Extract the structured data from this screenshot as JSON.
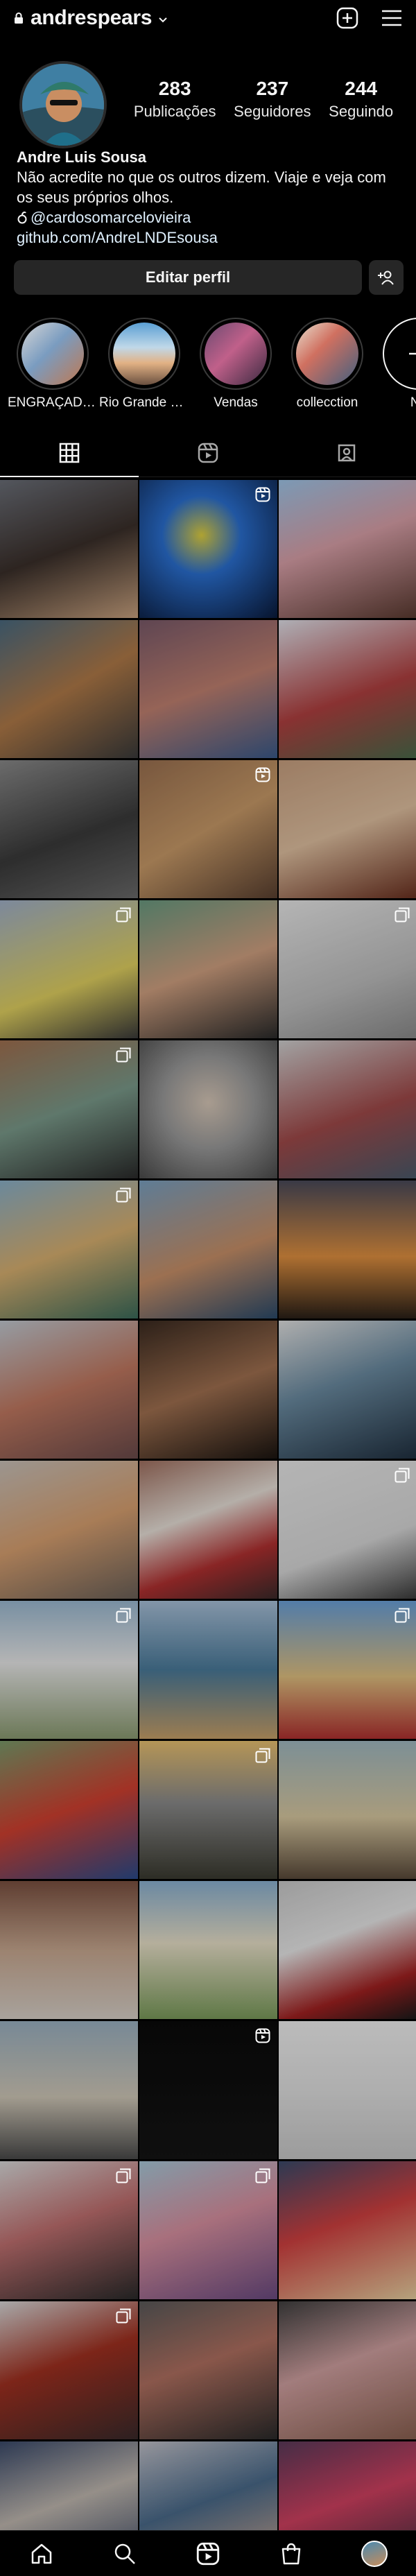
{
  "header": {
    "username": "andrespears"
  },
  "profile": {
    "stats": [
      {
        "value": "283",
        "label": "Publicações"
      },
      {
        "value": "237",
        "label": "Seguidores"
      },
      {
        "value": "244",
        "label": "Seguindo"
      }
    ],
    "name": "Andre Luis Sousa",
    "bio_line1": "Não acredite no que os outros dizem. Viaje e veja com",
    "bio_line2": "os seus próprios olhos.",
    "threads_handle": "@cardosomarcelovieira",
    "link": "github.com/AndreLNDEsousa",
    "edit_button": "Editar perfil"
  },
  "highlights": [
    {
      "label": "ENGRAÇADOS"
    },
    {
      "label": "Rio Grande do..."
    },
    {
      "label": "Vendas"
    },
    {
      "label": "collecction"
    },
    {
      "label": "No"
    }
  ],
  "icons": {
    "add": "plus-square-icon",
    "menu": "hamburger-menu-icon",
    "grid_tab": "grid-icon",
    "reels_tab": "reels-icon",
    "tagged_tab": "tagged-icon",
    "home": "home-icon",
    "search": "search-icon",
    "reels": "reels-icon",
    "shop": "shop-icon"
  },
  "colors": {
    "background": "#000000",
    "button": "#262626",
    "text": "#f5f5f5"
  }
}
